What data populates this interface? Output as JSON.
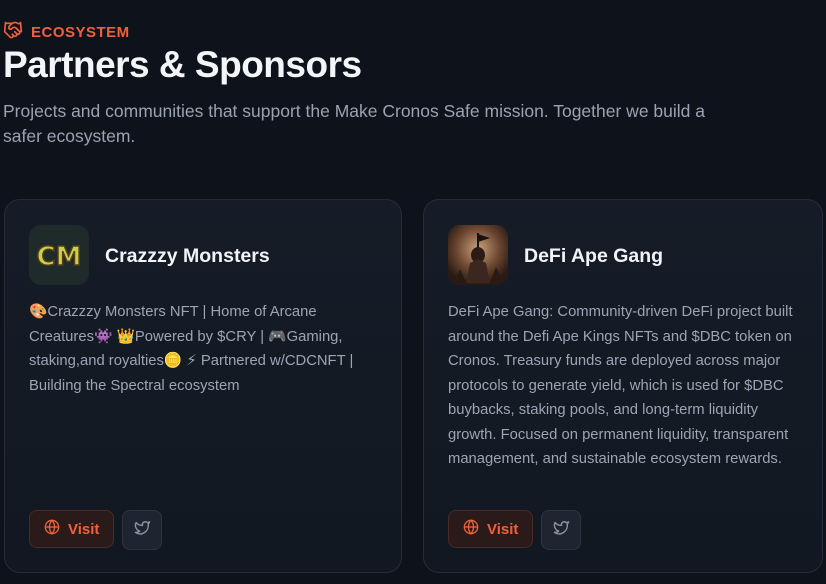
{
  "header": {
    "eyebrow": "ECOSYSTEM",
    "title": "Partners & Sponsors",
    "subtitle": "Projects and communities that support the Make Cronos Safe mission. Together we build a safer ecosystem."
  },
  "colors": {
    "accent": "#f0613a",
    "background": "#0e121a",
    "card": "#151b25"
  },
  "partners": [
    {
      "name": "Crazzzy Monsters",
      "logo_text": "CM",
      "description": "🎨Crazzzy Monsters NFT | Home of Arcane Creatures👾 👑Powered by $CRY | 🎮Gaming, staking,and royalties🪙 ⚡ Partnered w/CDCNFT | Building the Spectral ecosystem",
      "visit_label": "Visit"
    },
    {
      "name": "DeFi Ape Gang",
      "description": "DeFi Ape Gang: Community-driven DeFi project built around the Defi Ape Kings NFTs and $DBC token on Cronos. Treasury funds are deployed across major protocols to generate yield, which is used for $DBC buybacks, staking pools, and long-term liquidity growth. Focused on permanent liquidity, transparent management, and sustainable ecosystem rewards.",
      "visit_label": "Visit"
    }
  ]
}
